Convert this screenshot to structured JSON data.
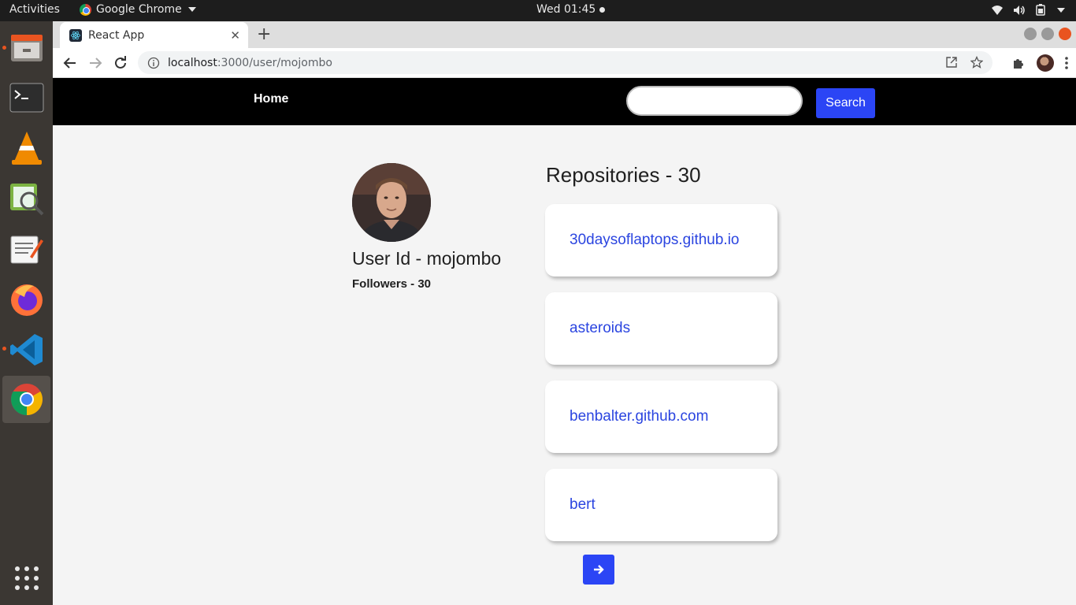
{
  "topbar": {
    "activities": "Activities",
    "app_name": "Google Chrome",
    "clock": "Wed 01:45"
  },
  "dock": {
    "items": [
      "file-manager",
      "terminal",
      "vlc",
      "image-viewer",
      "text-editor",
      "firefox",
      "vscode",
      "chrome",
      "show-apps"
    ]
  },
  "browser": {
    "tab_title": "React App",
    "new_tab": "+",
    "url_host": "localhost",
    "url_path": ":3000/user/mojombo"
  },
  "navbar": {
    "home": "Home",
    "search_value": "",
    "search_button": "Search"
  },
  "profile": {
    "user_id": "User Id - mojombo",
    "followers": "Followers - 30"
  },
  "repositories": {
    "title": "Repositories - 30",
    "items": [
      {
        "name": "30daysoflaptops.github.io"
      },
      {
        "name": "asteroids"
      },
      {
        "name": "benbalter.github.com"
      },
      {
        "name": "bert"
      }
    ]
  },
  "colors": {
    "accent": "#2b45f5",
    "navbar": "#000000",
    "link": "#2b45e0"
  }
}
